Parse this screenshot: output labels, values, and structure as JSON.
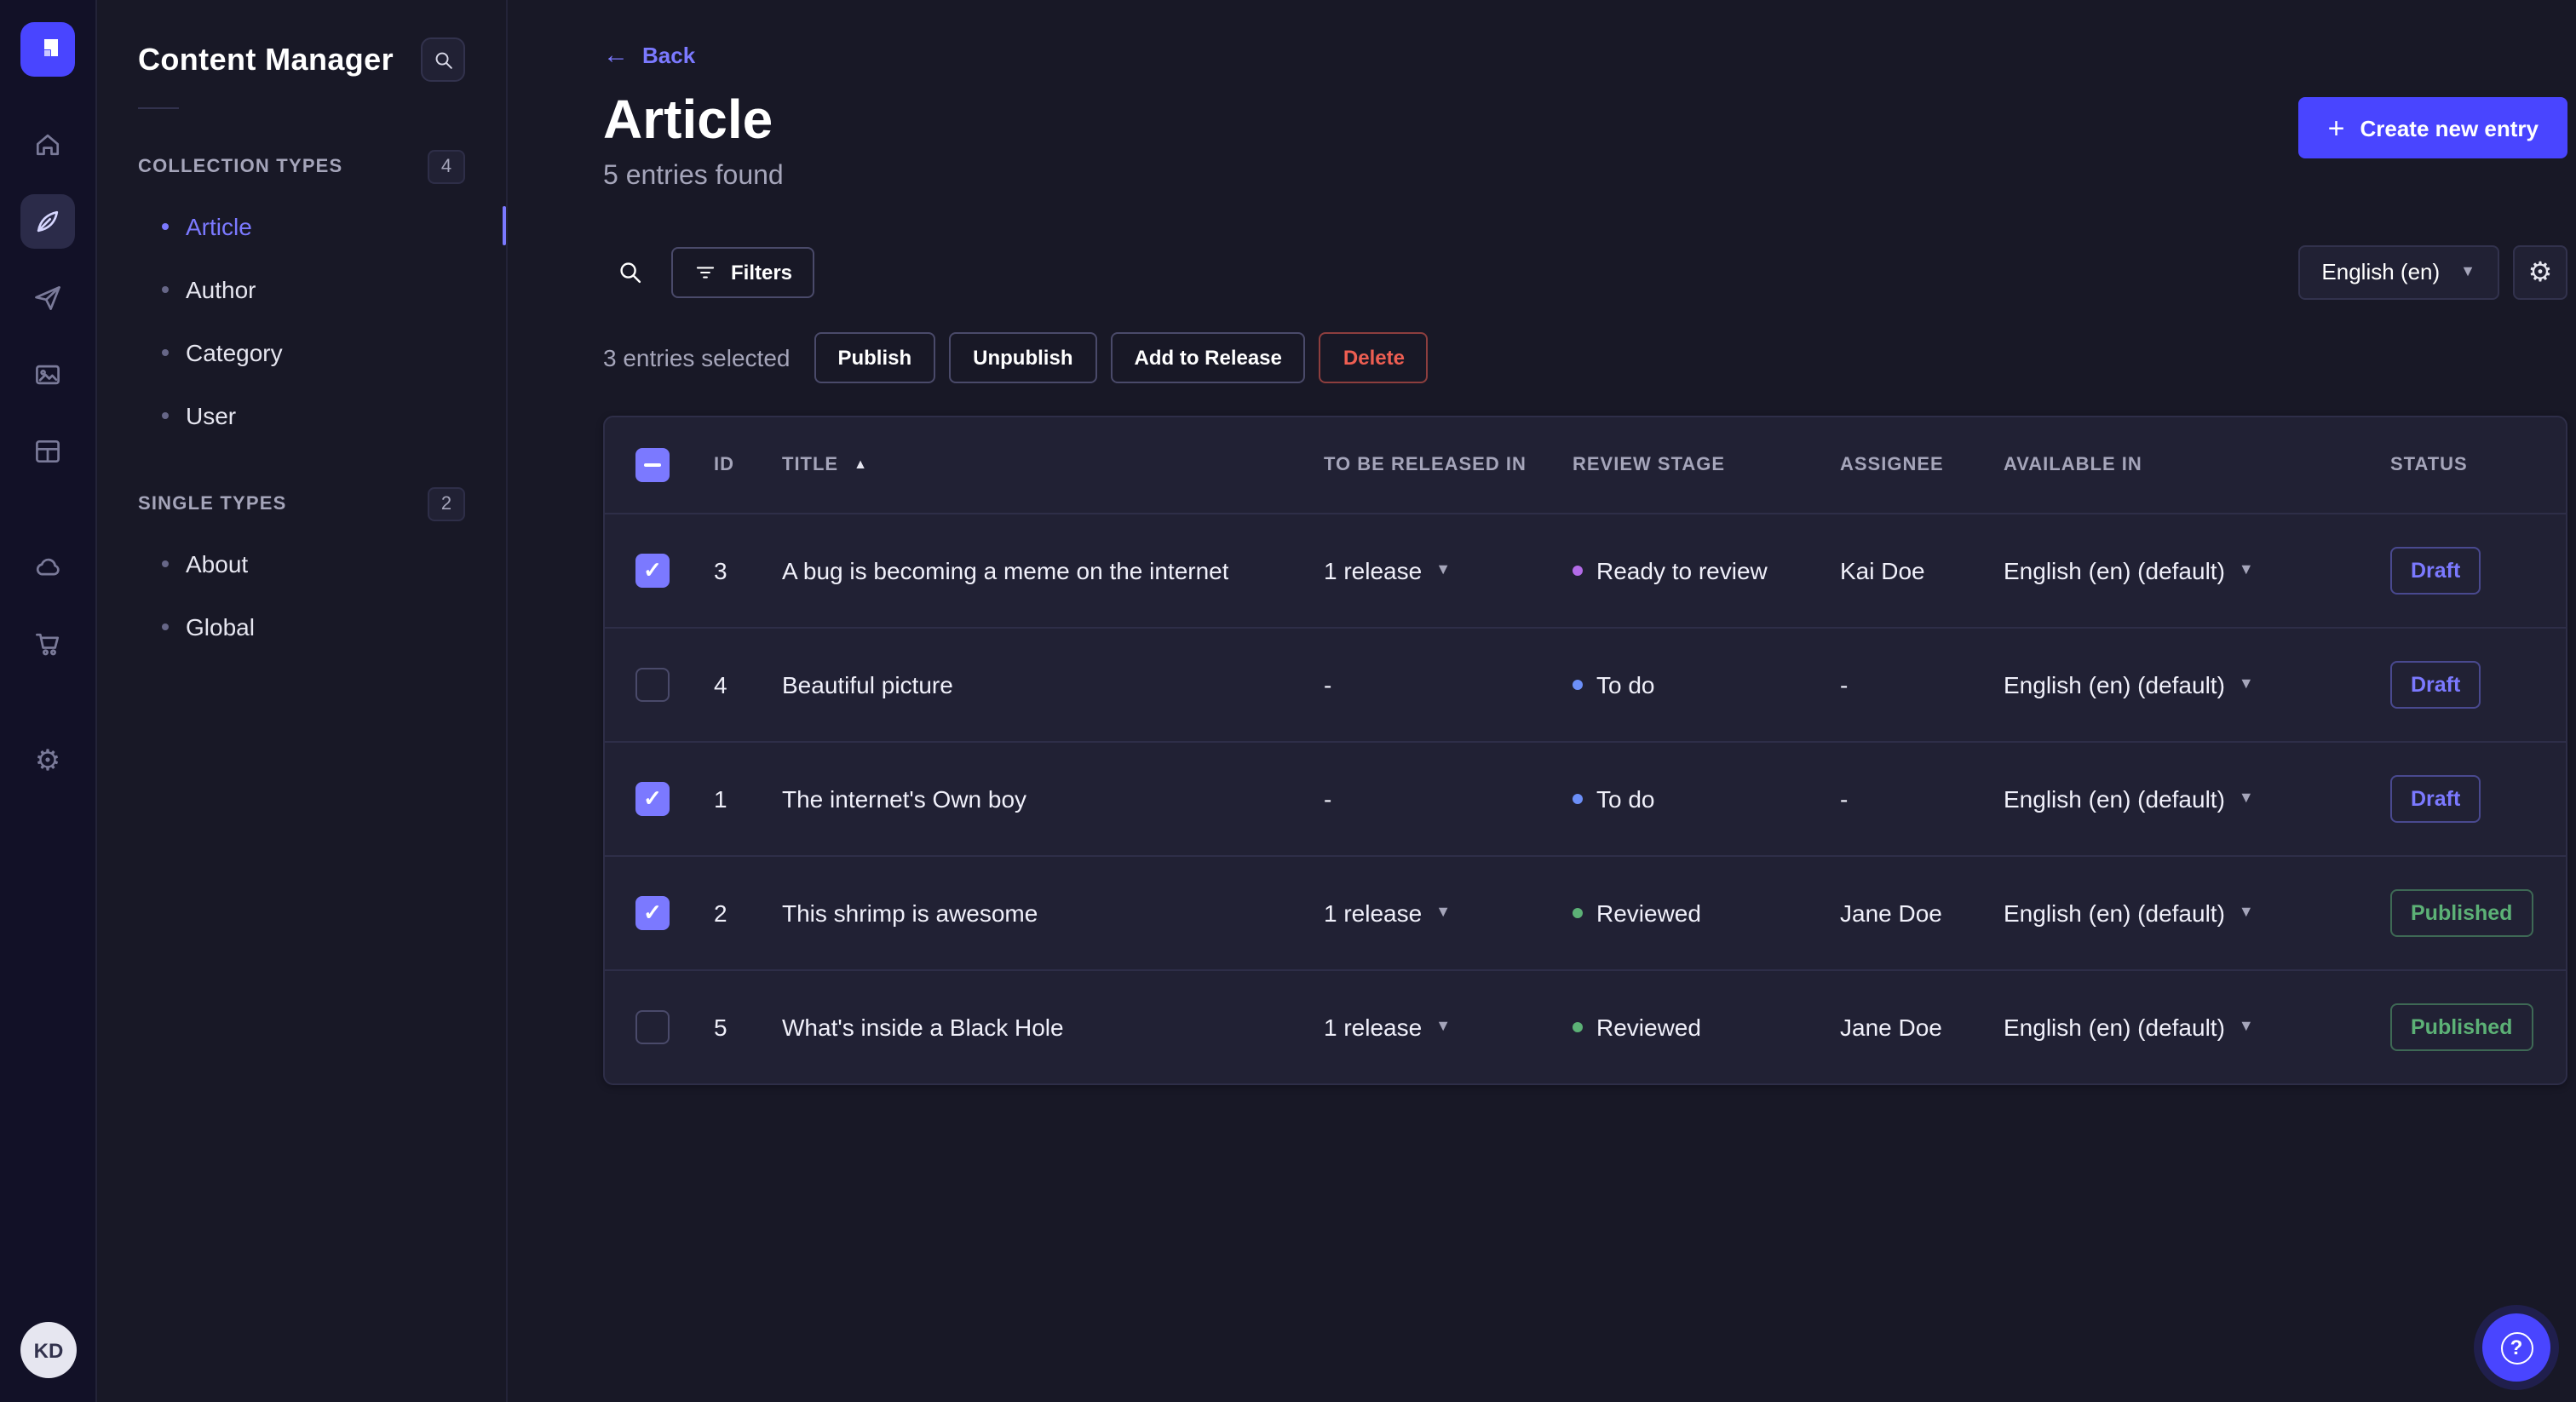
{
  "colors": {
    "accent": "#4945ff",
    "link": "#7b79ff",
    "draft": "#7b79ff",
    "published": "#5cb176",
    "stage_ready_to_review": "#b36be8",
    "stage_to_do": "#6c8ff8",
    "stage_reviewed": "#5cb176",
    "danger": "#ee5e52"
  },
  "rail": {
    "logo_icon": "strapi-logo-icon",
    "icons": [
      "home-icon",
      "content-manager-icon",
      "releases-icon",
      "media-library-icon",
      "content-type-builder-icon",
      "cloud-icon",
      "marketplace-icon",
      "settings-icon"
    ],
    "avatar_initials": "KD"
  },
  "sidebar": {
    "title": "Content Manager",
    "search_icon": "search-icon",
    "sections": [
      {
        "label": "COLLECTION TYPES",
        "count": "4",
        "items": [
          {
            "label": "Article",
            "active": true
          },
          {
            "label": "Author",
            "active": false
          },
          {
            "label": "Category",
            "active": false
          },
          {
            "label": "User",
            "active": false
          }
        ]
      },
      {
        "label": "SINGLE TYPES",
        "count": "2",
        "items": [
          {
            "label": "About",
            "active": false
          },
          {
            "label": "Global",
            "active": false
          }
        ]
      }
    ]
  },
  "header": {
    "back": "Back",
    "title": "Article",
    "subtitle": "5 entries found",
    "create_button": "Create new entry"
  },
  "toolbar": {
    "filters": "Filters",
    "locale_select": "English (en)"
  },
  "selection": {
    "text": "3 entries selected",
    "publish": "Publish",
    "unpublish": "Unpublish",
    "add_to_release": "Add to Release",
    "delete": "Delete"
  },
  "table": {
    "headers": [
      "ID",
      "TITLE",
      "TO BE RELEASED IN",
      "REVIEW STAGE",
      "ASSIGNEE",
      "AVAILABLE IN",
      "STATUS"
    ],
    "sort_column": "TITLE",
    "sort_direction": "asc",
    "rows": [
      {
        "checked": true,
        "id": "3",
        "title": "A bug is becoming a meme on the internet",
        "release": "1 release",
        "stage": "Ready to review",
        "assignee": "Kai Doe",
        "locale": "English (en) (default)",
        "status": "Draft"
      },
      {
        "checked": false,
        "id": "4",
        "title": "Beautiful picture",
        "release": "-",
        "stage": "To do",
        "assignee": "-",
        "locale": "English (en) (default)",
        "status": "Draft"
      },
      {
        "checked": true,
        "id": "1",
        "title": "The internet's Own boy",
        "release": "-",
        "stage": "To do",
        "assignee": "-",
        "locale": "English (en) (default)",
        "status": "Draft"
      },
      {
        "checked": true,
        "id": "2",
        "title": "This shrimp is awesome",
        "release": "1 release",
        "stage": "Reviewed",
        "assignee": "Jane Doe",
        "locale": "English (en) (default)",
        "status": "Published"
      },
      {
        "checked": false,
        "id": "5",
        "title": "What's inside a Black Hole",
        "release": "1 release",
        "stage": "Reviewed",
        "assignee": "Jane Doe",
        "locale": "English (en) (default)",
        "status": "Published"
      }
    ]
  },
  "footer": {
    "help": "?"
  }
}
